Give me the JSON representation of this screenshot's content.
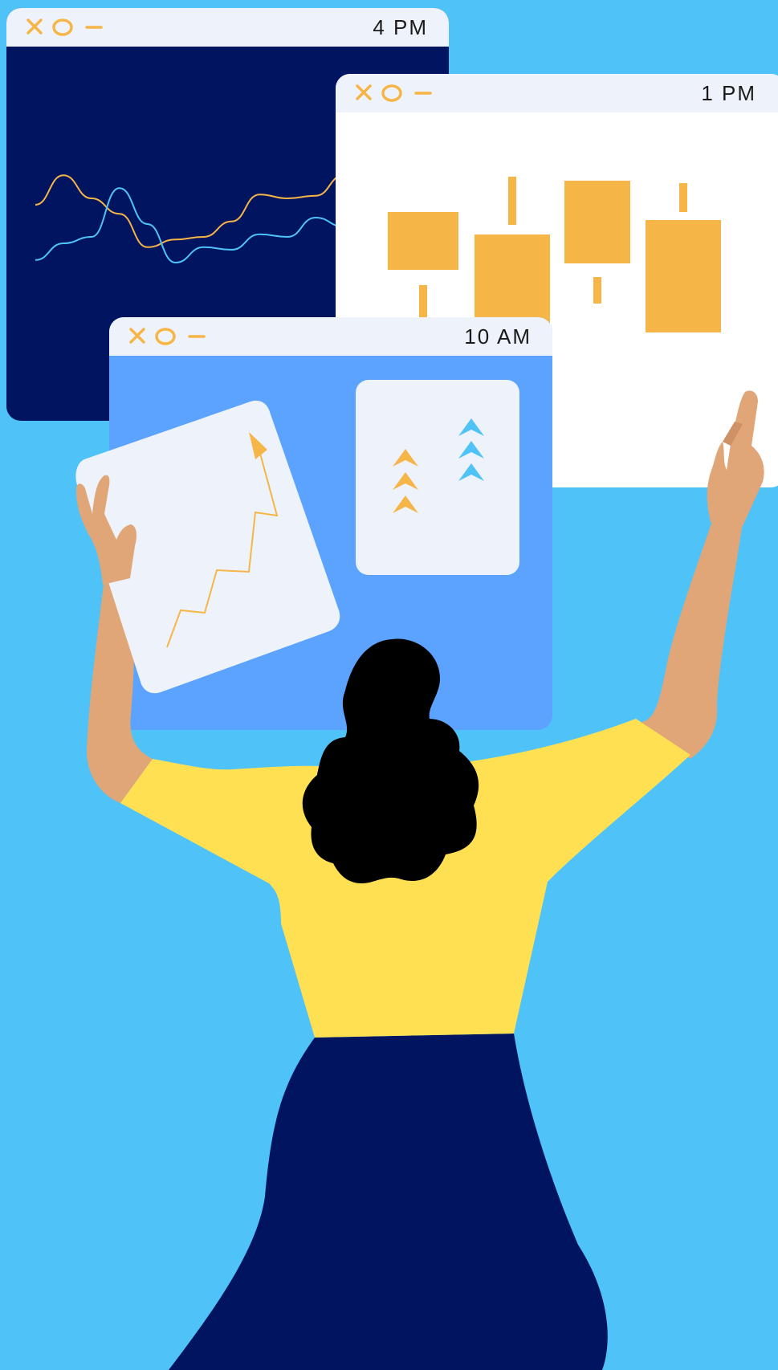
{
  "colors": {
    "background": "#4fc3f7",
    "titlebar": "#eef3fb",
    "navy_window": "#00145f",
    "white_window": "#ffffff",
    "blue_window": "#5ba3ff",
    "accent_orange": "#f6b547",
    "accent_blue": "#4fc3f7",
    "skin": "#e0a678",
    "shirt": "#ffe052",
    "skirt": "#00145f",
    "hair": "#000000",
    "card": "#eef3fb"
  },
  "windows": [
    {
      "id": "window-4pm",
      "time": "4 PM",
      "controls": [
        "close-icon",
        "circle-icon",
        "minimize-icon"
      ]
    },
    {
      "id": "window-1pm",
      "time": "1 PM",
      "controls": [
        "close-icon",
        "circle-icon",
        "minimize-icon"
      ]
    },
    {
      "id": "window-10am",
      "time": "10 AM",
      "controls": [
        "close-icon",
        "circle-icon",
        "minimize-icon"
      ]
    }
  ],
  "chart_data": [
    {
      "type": "line",
      "series": [
        {
          "values": [
            0.55,
            0.78,
            0.6,
            0.48,
            0.22,
            0.28,
            0.3,
            0.42,
            0.63,
            0.6,
            0.62,
            0.78
          ]
        },
        {
          "values": [
            0.12,
            0.25,
            0.3,
            0.68,
            0.4,
            0.1,
            0.22,
            0.2,
            0.32,
            0.3,
            0.45,
            0.38
          ]
        }
      ]
    },
    {
      "type": "bar",
      "values": [
        72,
        116,
        103,
        140
      ]
    }
  ]
}
